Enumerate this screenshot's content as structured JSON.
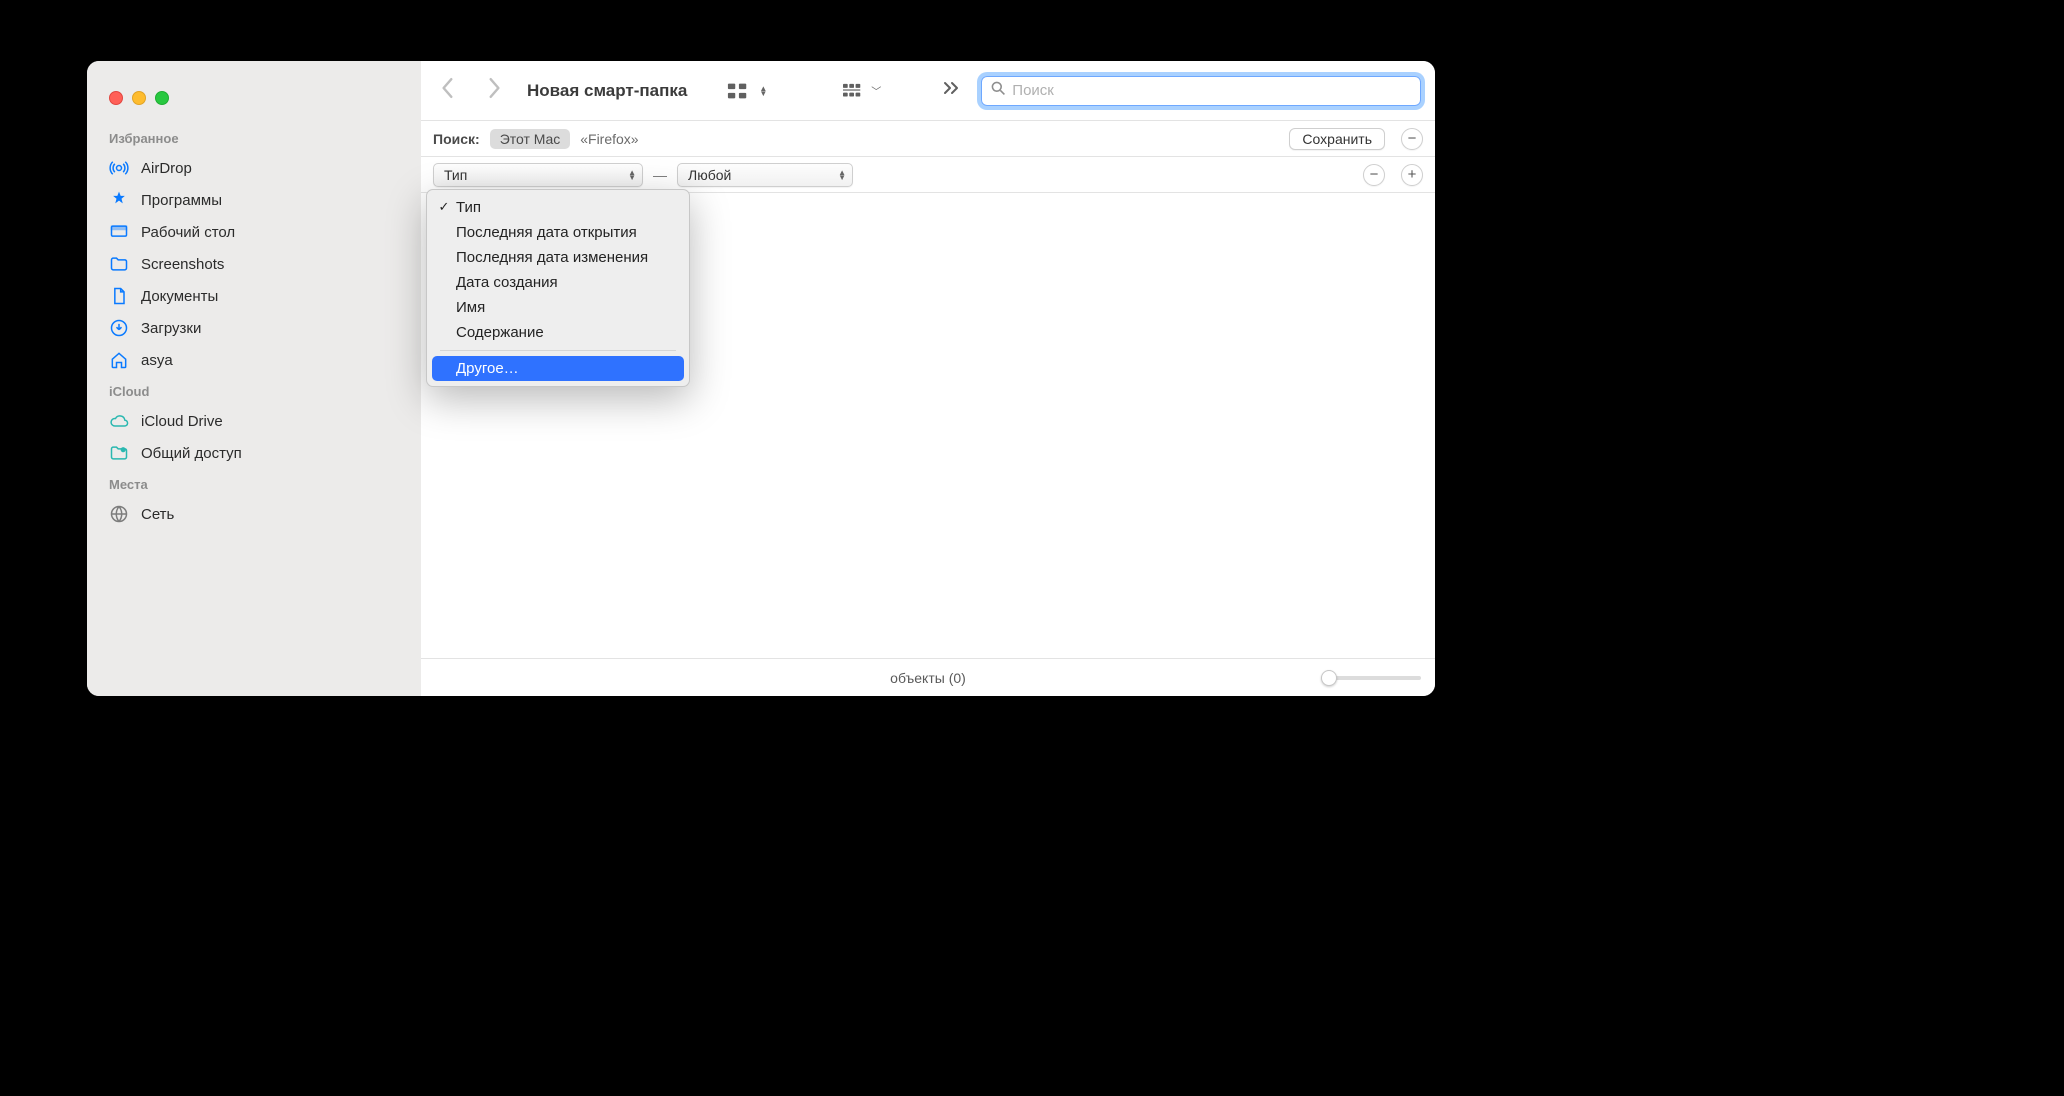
{
  "sidebar": {
    "sections": [
      {
        "heading": "Избранное",
        "items": [
          {
            "id": "airdrop",
            "label": "AirDrop"
          },
          {
            "id": "apps",
            "label": "Программы"
          },
          {
            "id": "desktop",
            "label": "Рабочий стол"
          },
          {
            "id": "screenshots",
            "label": "Screenshots"
          },
          {
            "id": "documents",
            "label": "Документы"
          },
          {
            "id": "downloads",
            "label": "Загрузки"
          },
          {
            "id": "home",
            "label": "asya"
          }
        ]
      },
      {
        "heading": "iCloud",
        "items": [
          {
            "id": "iclouddrive",
            "label": "iCloud Drive"
          },
          {
            "id": "shared",
            "label": "Общий доступ"
          }
        ]
      },
      {
        "heading": "Места",
        "items": [
          {
            "id": "network",
            "label": "Сеть"
          }
        ]
      }
    ]
  },
  "toolbar": {
    "title": "Новая смарт-папка",
    "search_placeholder": "Поиск"
  },
  "scope": {
    "label": "Поиск:",
    "primary": "Этот Mac",
    "secondary": "«Firefox»",
    "save": "Сохранить"
  },
  "criteria": {
    "attr_selected": "Тип",
    "value_selected": "Любой",
    "dropdown": {
      "checked": 0,
      "items": [
        "Тип",
        "Последняя дата открытия",
        "Последняя дата изменения",
        "Дата создания",
        "Имя",
        "Содержание"
      ],
      "other": "Другое…",
      "highlighted": "other"
    }
  },
  "status": {
    "text": "объекты (0)"
  }
}
